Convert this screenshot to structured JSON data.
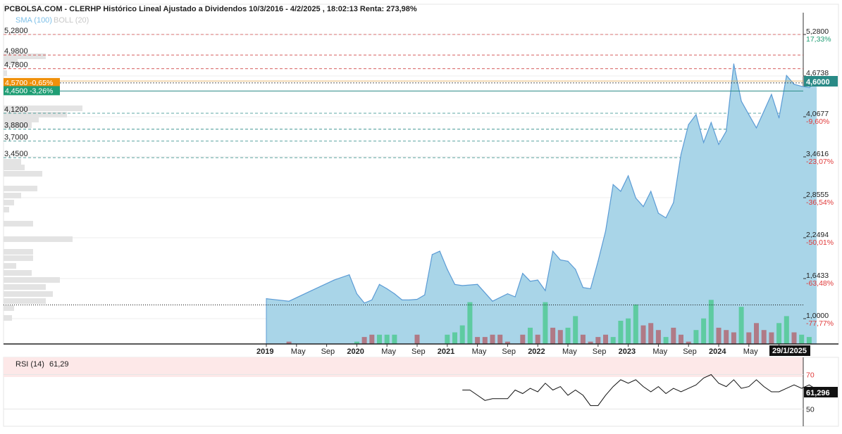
{
  "header": {
    "title": "PCBOLSA.COM - CLERHP Histórico Lineal Ajustado a Dividendos 10/3/2016 - 4/2/2025 , 18:02:13 Renta: 273,98%",
    "indicator_sma": "SMA (100)",
    "indicator_boll": "BOLL (20)"
  },
  "colors": {
    "area_fill": "#a9d5e8",
    "area_line": "#5b9bd5",
    "volume_up": "#5ecba1",
    "volume_down": "#b07a86",
    "profile_bar": "#e3e3e3",
    "level_line_red": "#d04848",
    "level_line_teal": "#2a8a86",
    "orange_badge": "#f0900a",
    "green_badge": "#1f9e74",
    "positive_pct": "#1f9e74",
    "negative_pct": "#e03a3a"
  },
  "left_price_labels": [
    "5,2800",
    "4,9800",
    "4,7800",
    "4,1200",
    "3,8800",
    "3,7000",
    "3,4500"
  ],
  "left_badges": [
    {
      "text": "4,5700  -0,65%",
      "color": "#f0900a"
    },
    {
      "text": "4,4500  -3,26%",
      "color": "#1f9e74"
    }
  ],
  "right_axis": [
    {
      "price": "5,2800",
      "pct": "17,33%",
      "sign": "pos"
    },
    {
      "price": "4,6738",
      "pct": "",
      "sign": ""
    },
    {
      "price": "4,0677",
      "pct": "-9,60%",
      "sign": "neg"
    },
    {
      "price": "3,4616",
      "pct": "-23,07%",
      "sign": "neg"
    },
    {
      "price": "2,8555",
      "pct": "-36,54%",
      "sign": "neg"
    },
    {
      "price": "2,2494",
      "pct": "-50,01%",
      "sign": "neg"
    },
    {
      "price": "1,6433",
      "pct": "-63,48%",
      "sign": "neg"
    },
    {
      "price": "1,0000",
      "pct": "-77,77%",
      "sign": "neg"
    }
  ],
  "current_price_badge": "4,6000",
  "x_axis_labels": [
    {
      "label": "2019",
      "bold": true
    },
    {
      "label": "May",
      "bold": false
    },
    {
      "label": "Sep",
      "bold": false
    },
    {
      "label": "2020",
      "bold": true
    },
    {
      "label": "May",
      "bold": false
    },
    {
      "label": "Sep",
      "bold": false
    },
    {
      "label": "2021",
      "bold": true
    },
    {
      "label": "May",
      "bold": false
    },
    {
      "label": "Sep",
      "bold": false
    },
    {
      "label": "2022",
      "bold": true
    },
    {
      "label": "May",
      "bold": false
    },
    {
      "label": "Sep",
      "bold": false
    },
    {
      "label": "2023",
      "bold": true
    },
    {
      "label": "May",
      "bold": false
    },
    {
      "label": "Sep",
      "bold": false
    },
    {
      "label": "2024",
      "bold": true
    },
    {
      "label": "May",
      "bold": false
    },
    {
      "label": "Se",
      "bold": false
    }
  ],
  "date_badge": "29/1/2025",
  "rsi": {
    "title": "RSI (14)",
    "value": "61,29",
    "axis_labels": [
      "70",
      "50"
    ],
    "current_badge": "61,296"
  },
  "chart_data": {
    "type": "area",
    "x_range": [
      "2018-11",
      "2025-02"
    ],
    "ylim": [
      1.0,
      5.5
    ],
    "price_levels_red": [
      5.28,
      4.98,
      4.78
    ],
    "price_levels_teal": [
      4.12,
      3.88,
      3.7,
      3.45
    ],
    "horizontal_marks": [
      4.57,
      4.6,
      4.45
    ],
    "baseline_value": 1.22,
    "series": [
      {
        "x": [
          "2019-01",
          "2019-04",
          "2019-07",
          "2019-10",
          "2019-12",
          "2020-01",
          "2020-02",
          "2020-03",
          "2020-04",
          "2020-05",
          "2020-06",
          "2020-07",
          "2020-08",
          "2020-09",
          "2020-10",
          "2020-11",
          "2020-12",
          "2021-01",
          "2021-02",
          "2021-03",
          "2021-05",
          "2021-07",
          "2021-09",
          "2021-10",
          "2021-11",
          "2021-12",
          "2022-01",
          "2022-02",
          "2022-03",
          "2022-04",
          "2022-05",
          "2022-06",
          "2022-07",
          "2022-08",
          "2022-09",
          "2022-10",
          "2022-11",
          "2022-12",
          "2023-01",
          "2023-02",
          "2023-03",
          "2023-04",
          "2023-05",
          "2023-06",
          "2023-07",
          "2023-08",
          "2023-09",
          "2023-10",
          "2023-11",
          "2023-12",
          "2024-01",
          "2024-02",
          "2024-03",
          "2024-04",
          "2024-05",
          "2024-06",
          "2024-07",
          "2024-08",
          "2024-09",
          "2024-10",
          "2024-11",
          "2024-12",
          "2025-01",
          "2025-02"
        ],
        "values": [
          1.32,
          1.28,
          1.45,
          1.62,
          1.7,
          1.4,
          1.25,
          1.3,
          1.55,
          1.48,
          1.4,
          1.3,
          1.3,
          1.31,
          1.38,
          2.0,
          2.05,
          1.78,
          1.55,
          1.53,
          1.55,
          1.28,
          1.4,
          1.35,
          1.72,
          1.6,
          1.62,
          1.45,
          2.05,
          1.92,
          1.9,
          1.78,
          1.5,
          1.48,
          1.9,
          2.35,
          3.05,
          2.95,
          3.18,
          2.85,
          2.72,
          2.95,
          2.62,
          2.55,
          2.78,
          3.5,
          3.95,
          4.1,
          3.68,
          3.98,
          3.65,
          3.85,
          4.85,
          4.3,
          4.1,
          3.9,
          4.15,
          4.4,
          4.05,
          4.68,
          4.55,
          4.52,
          4.5,
          4.6
        ]
      }
    ],
    "volume": {
      "x": [
        "2019-04",
        "2020-01",
        "2020-02",
        "2020-03",
        "2020-04",
        "2020-05",
        "2020-06",
        "2020-09",
        "2021-01",
        "2021-02",
        "2021-03",
        "2021-04",
        "2021-05",
        "2021-06",
        "2021-07",
        "2021-08",
        "2021-09",
        "2021-11",
        "2021-12",
        "2022-01",
        "2022-02",
        "2022-03",
        "2022-04",
        "2022-05",
        "2022-06",
        "2022-07",
        "2022-08",
        "2022-09",
        "2022-10",
        "2022-11",
        "2022-12",
        "2023-01",
        "2023-02",
        "2023-03",
        "2023-04",
        "2023-05",
        "2023-06",
        "2023-07",
        "2023-08",
        "2023-09",
        "2023-10",
        "2023-11",
        "2023-12",
        "2024-01",
        "2024-02",
        "2024-03",
        "2024-04",
        "2024-05",
        "2024-06",
        "2024-07",
        "2024-08",
        "2024-09",
        "2024-10",
        "2024-11",
        "2024-12",
        "2025-01"
      ],
      "values": [
        1,
        1,
        3,
        4,
        4,
        4,
        4,
        4,
        4,
        5,
        8,
        18,
        3,
        3,
        4,
        4,
        1,
        4,
        7,
        4,
        18,
        7,
        6,
        7,
        12,
        4,
        1,
        3,
        4,
        3,
        10,
        11,
        17,
        8,
        9,
        6,
        3,
        7,
        4,
        1,
        6,
        11,
        19,
        7,
        6,
        5,
        16,
        5,
        9,
        6,
        5,
        9,
        12,
        5,
        4,
        3
      ],
      "up": [
        false,
        true,
        false,
        false,
        true,
        true,
        true,
        false,
        true,
        true,
        true,
        true,
        false,
        false,
        false,
        false,
        false,
        false,
        true,
        false,
        true,
        false,
        false,
        true,
        true,
        false,
        false,
        false,
        false,
        true,
        true,
        true,
        true,
        false,
        false,
        false,
        true,
        false,
        false,
        false,
        true,
        true,
        true,
        false,
        false,
        false,
        true,
        false,
        false,
        false,
        false,
        true,
        true,
        false,
        true,
        true
      ]
    },
    "rsi_series": {
      "ylim": [
        40,
        80
      ],
      "levels": [
        70,
        50
      ],
      "x": [
        "2021-03",
        "2021-04",
        "2021-05",
        "2021-06",
        "2021-07",
        "2021-09",
        "2021-10",
        "2021-11",
        "2021-12",
        "2022-01",
        "2022-02",
        "2022-03",
        "2022-04",
        "2022-05",
        "2022-06",
        "2022-07",
        "2022-08",
        "2022-09",
        "2022-10",
        "2022-11",
        "2022-12",
        "2023-01",
        "2023-02",
        "2023-03",
        "2023-04",
        "2023-05",
        "2023-06",
        "2023-07",
        "2023-08",
        "2023-09",
        "2023-10",
        "2023-11",
        "2023-12",
        "2024-01",
        "2024-02",
        "2024-03",
        "2024-04",
        "2024-05",
        "2024-06",
        "2024-07",
        "2024-08",
        "2024-09",
        "2024-10",
        "2024-11",
        "2024-12",
        "2025-01",
        "2025-02"
      ],
      "values": [
        61,
        61,
        58,
        55,
        56,
        56,
        61,
        59,
        62,
        60,
        65,
        61,
        63,
        58,
        61,
        58,
        52,
        52,
        58,
        63,
        67,
        65,
        67,
        63,
        60,
        63,
        59,
        62,
        60,
        62,
        64,
        68,
        70,
        65,
        63,
        67,
        62,
        63,
        67,
        63,
        60,
        60,
        62,
        64,
        62,
        64,
        61.3
      ]
    }
  }
}
